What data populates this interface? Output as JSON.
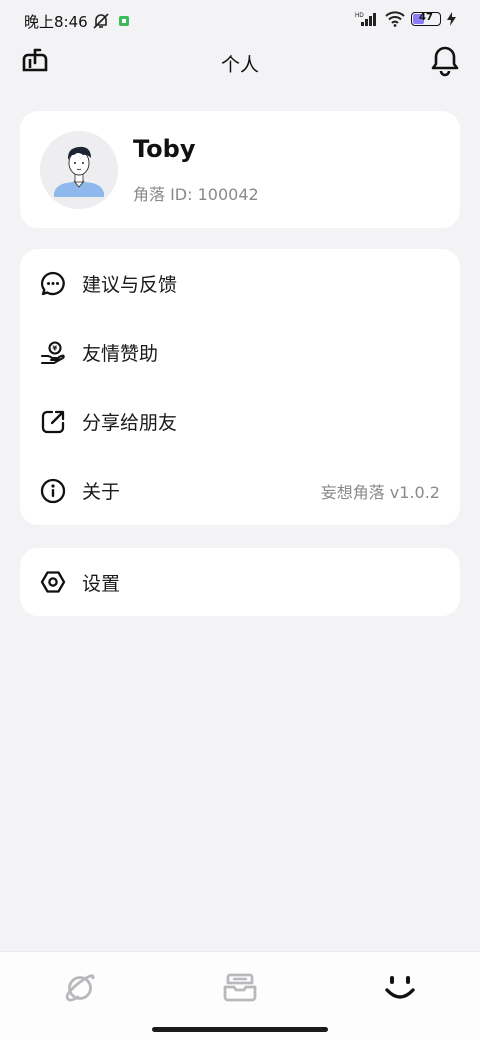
{
  "status_bar": {
    "time": "晚上8:46",
    "battery_level": "47",
    "network_label": "HD"
  },
  "header": {
    "title": "个人"
  },
  "profile": {
    "name": "Toby",
    "id_text": "角落 ID: 100042"
  },
  "menu": {
    "items": [
      {
        "label": "建议与反馈",
        "icon": "chat-bubble-icon"
      },
      {
        "label": "友情赞助",
        "icon": "donate-hand-icon"
      },
      {
        "label": "分享给朋友",
        "icon": "share-external-icon"
      },
      {
        "label": "关于",
        "icon": "info-icon",
        "value": "妄想角落 v1.0.2"
      }
    ]
  },
  "settings": {
    "label": "设置",
    "icon": "settings-hexagon-icon"
  },
  "tab_bar": {
    "tabs": [
      {
        "icon": "planet-icon",
        "active": false
      },
      {
        "icon": "inbox-tray-icon",
        "active": false
      },
      {
        "icon": "smile-face-icon",
        "active": true
      }
    ],
    "active_color": "#111111",
    "inactive_color": "#b9b9bd"
  },
  "colors": {
    "background": "#f3f2f5",
    "card": "#ffffff",
    "secondary_text": "#8a8a8e"
  }
}
